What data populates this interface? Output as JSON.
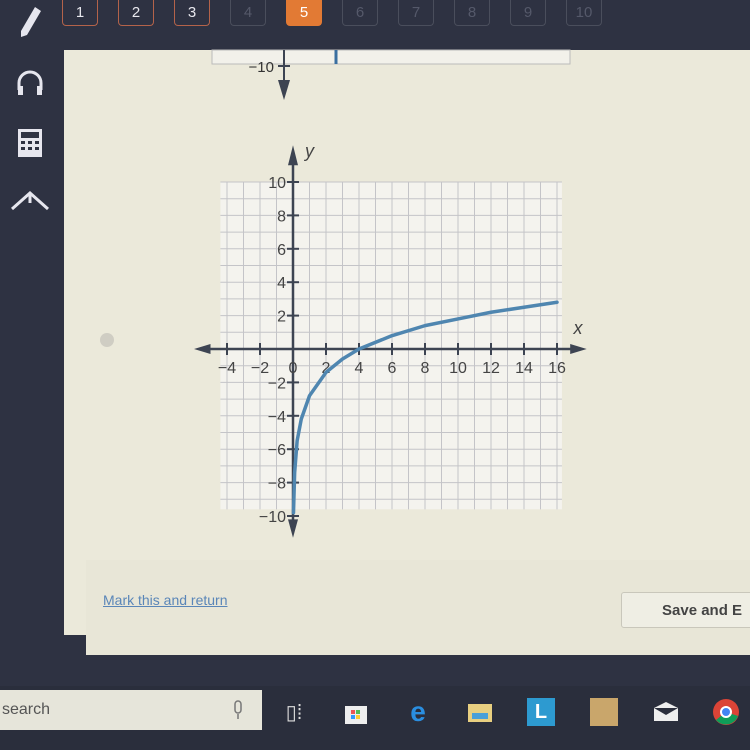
{
  "question_nav": {
    "items": [
      {
        "label": "1",
        "state": "answered"
      },
      {
        "label": "2",
        "state": "answered"
      },
      {
        "label": "3",
        "state": "answered"
      },
      {
        "label": "4",
        "state": "locked"
      },
      {
        "label": "5",
        "state": "current"
      },
      {
        "label": "6",
        "state": "locked"
      },
      {
        "label": "7",
        "state": "locked"
      },
      {
        "label": "8",
        "state": "locked"
      },
      {
        "label": "9",
        "state": "locked"
      },
      {
        "label": "10",
        "state": "locked"
      }
    ],
    "accent_color": "#e27a34"
  },
  "sidebar": {
    "icons": [
      "pencil-icon",
      "headphones-icon",
      "calculator-icon",
      "reference-icon"
    ]
  },
  "previous_graph": {
    "y_tick_label": "−10"
  },
  "footer": {
    "mark_link": "Mark this and return",
    "save_button": "Save and E"
  },
  "taskbar": {
    "search_placeholder": "search",
    "icons": [
      "microphone-icon",
      "task-view-icon",
      "store-icon",
      "edge-icon",
      "file-explorer-icon",
      "l-app-icon",
      "app-icon",
      "mail-icon",
      "chrome-icon"
    ]
  },
  "chart_data": {
    "type": "line",
    "xlabel": "x",
    "ylabel": "y",
    "xlim": [
      -4,
      16
    ],
    "ylim": [
      -10,
      10
    ],
    "x_ticks": [
      "−4",
      "−2",
      "0",
      "2",
      "4",
      "6",
      "8",
      "10",
      "12",
      "14",
      "16"
    ],
    "y_ticks": [
      "10",
      "8",
      "6",
      "4",
      "2",
      "−2",
      "−4",
      "−6",
      "−8",
      "−10"
    ],
    "grid": true,
    "curve_color": "#4f86b0",
    "series": [
      {
        "x": [
          0.03,
          0.1,
          0.25,
          0.5,
          1,
          2,
          3,
          4,
          6,
          8,
          10,
          12,
          14,
          16
        ],
        "y": [
          -9.8,
          -7.4,
          -5.5,
          -4.2,
          -2.8,
          -1.4,
          -0.6,
          0,
          0.8,
          1.4,
          1.8,
          2.2,
          2.5,
          2.8
        ]
      }
    ]
  }
}
